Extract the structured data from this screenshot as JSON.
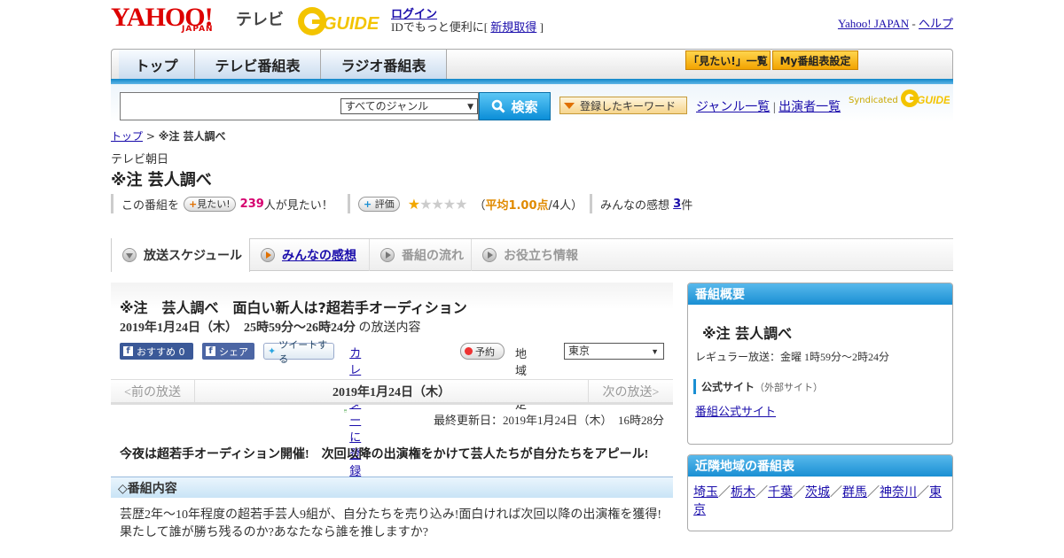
{
  "header": {
    "yahoo_logo": "YAHOO!",
    "japan": "JAPAN",
    "tv": "テレビ",
    "gguide": "GUIDE",
    "login": "ログイン",
    "login_desc_prefix": "IDでもっと便利に[ ",
    "register": "新規取得",
    "login_desc_suffix": " ]",
    "yahoo_japan_link": "Yahoo! JAPAN",
    "separator": " - ",
    "help_link": "ヘルプ"
  },
  "nav": {
    "tabs": [
      "トップ",
      "テレビ番組表",
      "ラジオ番組表"
    ],
    "mitai_list": "「見たい!」一覧",
    "my_settings": "My番組表設定"
  },
  "search": {
    "genre_selected": "すべてのジャンル",
    "search_button": "検索",
    "keyword_button": "登録したキーワード",
    "genre_list": "ジャンル一覧",
    "divider": " | ",
    "performer_list": "出演者一覧",
    "syndicated": "Syndicated"
  },
  "breadcrumb": {
    "top": "トップ",
    "sep": " > ",
    "current": "※注 芸人調べ"
  },
  "program": {
    "channel": "テレビ朝日",
    "title": "※注 芸人調べ",
    "stats": {
      "this_program": "この番組を",
      "mitai_pill": "見たい!",
      "mitai_count": "239",
      "mitai_suffix": "人が見たい！",
      "rating_pill": "評価",
      "rating_stars": 1,
      "rating_avg_prefix": "（",
      "rating_avg": "平均1.00点",
      "rating_people": "/4人）",
      "impressions_label": "みんなの感想",
      "impressions_count": "3",
      "impressions_suffix": "件"
    }
  },
  "tabs": [
    "放送スケジュール",
    "みんなの感想",
    "番組の流れ",
    "お役立ち情報"
  ],
  "episode": {
    "title": "※注　芸人調べ　面白い新人は?超若手オーディション",
    "date": "2019年1月24日（木）　25時59分～26時24分",
    "date_suffix": " の放送内容",
    "recommend": "おすすめ 0",
    "share": "シェア",
    "tweet": "ツイートする",
    "calendar": "カレンダーに登録",
    "reserve": "予約",
    "region_label": "地域設定",
    "region_selected": "東京"
  },
  "pager": {
    "prev": "<前の放送",
    "current": "2019年1月24日（木）",
    "next": "次の放送>"
  },
  "updated": "最終更新日：2019年1月24日（木）　16時28分",
  "lead": "今夜は超若手オーディション開催!　次回以降の出演権をかけて芸人たちが自分たちをアピール!",
  "section_title": "◇番組内容",
  "description": "芸歴2年～10年程度の超若手芸人9組が、自分たちを売り込み!面白ければ次回以降の出演権を獲得!果たして誰が勝ち残るのか?あなたなら誰を推しますか?",
  "sidebar": {
    "overview_head": "番組概要",
    "overview_title": "※注 芸人調べ",
    "regular": "レギュラー放送：金曜 1時59分～2時24分",
    "official_label": "公式サイト",
    "official_note": "（外部サイト）",
    "official_link": "番組公式サイト",
    "nearby_head": "近隣地域の番組表",
    "regions": [
      "埼玉",
      "栃木",
      "千葉",
      "茨城",
      "群馬",
      "神奈川",
      "東京"
    ],
    "region_sep": "／"
  },
  "colors": {
    "accent_blue": "#1a8fd3",
    "link": "#1a0dab",
    "mitai_pink": "#d6006f",
    "rating_orange": "#e08a00"
  }
}
